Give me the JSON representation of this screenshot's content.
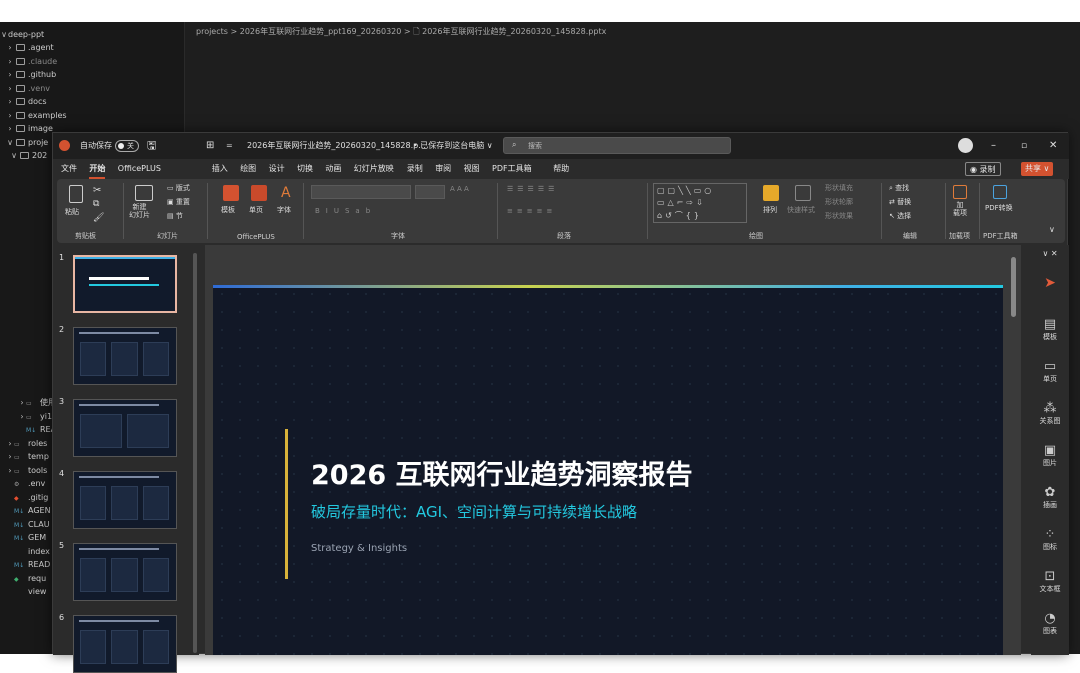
{
  "explorer": {
    "root": "deep-ppt",
    "items": [
      {
        "label": ".agent",
        "kind": "folder"
      },
      {
        "label": ".claude",
        "kind": "folder",
        "dim": true
      },
      {
        "label": ".github",
        "kind": "folder"
      },
      {
        "label": ".venv",
        "kind": "folder",
        "dim": true
      },
      {
        "label": "docs",
        "kind": "folder"
      },
      {
        "label": "examples",
        "kind": "folder"
      },
      {
        "label": "image",
        "kind": "folder"
      },
      {
        "label": "proje",
        "kind": "folder-open"
      },
      {
        "label": "202",
        "kind": "folder-open"
      }
    ],
    "lower_items": [
      {
        "label": "使用",
        "kind": "folder"
      },
      {
        "label": "yi1",
        "kind": "folder"
      },
      {
        "label": "REA",
        "kind": "md"
      },
      {
        "label": "roles",
        "kind": "folder"
      },
      {
        "label": "temp",
        "kind": "folder"
      },
      {
        "label": "tools",
        "kind": "folder"
      },
      {
        "label": ".env",
        "kind": "gear"
      },
      {
        "label": ".gitig",
        "kind": "git"
      },
      {
        "label": "AGEN",
        "kind": "md"
      },
      {
        "label": "CLAU",
        "kind": "md"
      },
      {
        "label": "GEM",
        "kind": "md"
      },
      {
        "label": "index",
        "kind": "code"
      },
      {
        "label": "READ",
        "kind": "md"
      },
      {
        "label": "requ",
        "kind": "py"
      },
      {
        "label": "view",
        "kind": "code"
      }
    ]
  },
  "breadcrumb": "projects > 2026年互联网行业趋势_ppt169_20260320 > 🗋 2026年互联网行业趋势_20260320_145828.pptx",
  "titlebar": {
    "autosave_label": "自动保存",
    "autosave_state": "关",
    "filename": "2026年互联网行业趋势_20260320_145828.p...",
    "save_status": "• 已保存到这台电脑 ∨",
    "search_placeholder": "搜索"
  },
  "menu": [
    "文件",
    "开始",
    "OfficePLUS",
    "插入",
    "绘图",
    "设计",
    "切换",
    "动画",
    "幻灯片放映",
    "录制",
    "审阅",
    "视图",
    "PDF工具箱",
    "帮助"
  ],
  "menu_active": "开始",
  "menu_right": {
    "record": "◉ 录制",
    "share": "共享 ∨"
  },
  "ribbon": {
    "paste": "粘贴",
    "clipboard": "剪贴板",
    "new_slide": "新建\n幻灯片",
    "layout": "版式",
    "reset": "重置",
    "section": "节",
    "slides_group": "幻灯片",
    "template": "模板",
    "single_page": "单页",
    "font_btn": "字体",
    "officeplus_group": "OfficePLUS",
    "font_group": "字体",
    "paragraph_group": "段落",
    "arrange": "排列",
    "quick_styles": "快速样式",
    "shape_fill": "形状填充",
    "shape_outline": "形状轮廓",
    "shape_effect": "形状效果",
    "drawing_group": "绘图",
    "find": "查找",
    "replace": "替换",
    "select": "选择",
    "editing_group": "编辑",
    "addin": "加\n载项",
    "addin_group": "加载项",
    "pdf_convert": "PDF转换",
    "pdf_group": "PDF工具箱"
  },
  "thumbnails": [
    {
      "num": "1",
      "selected": true
    },
    {
      "num": "2"
    },
    {
      "num": "3"
    },
    {
      "num": "4"
    },
    {
      "num": "5"
    },
    {
      "num": "6"
    }
  ],
  "slide": {
    "title": "2026 互联网行业趋势洞察报告",
    "subtitle": "破局存量时代：AGI、空间计算与可持续增长战略",
    "tagline": "Strategy & Insights",
    "colors": {
      "background": "#121827",
      "accent": "#23c9e0",
      "bar": "#d8b23a"
    }
  },
  "side_panel": [
    "模板",
    "单页",
    "关系图",
    "图片",
    "插画",
    "图标",
    "文本框",
    "图表"
  ]
}
